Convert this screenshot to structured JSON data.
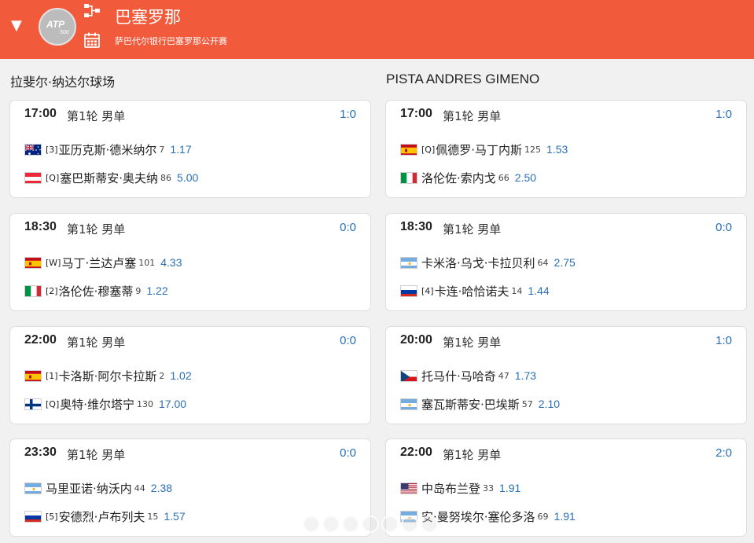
{
  "header": {
    "tournament_name": "巴塞罗那",
    "tournament_full": "萨巴代尔银行巴塞罗那公开赛",
    "logo_text": "ATP",
    "logo_number": "500",
    "accent_color": "#f15a3b"
  },
  "courts": [
    {
      "name": "拉斐尔·纳达尔球场",
      "matches": [
        {
          "time": "17:00",
          "round": "第1轮 男单",
          "score": "1:0",
          "p1": {
            "flag": "australia",
            "seed": "[3]",
            "name": "亚历克斯·德米纳尔",
            "rank": "7",
            "odds": "1.17"
          },
          "p2": {
            "flag": "austria",
            "seed": "[Q]",
            "name": "塞巴斯蒂安·奥夫纳",
            "rank": "86",
            "odds": "5.00"
          }
        },
        {
          "time": "18:30",
          "round": "第1轮 男单",
          "score": "0:0",
          "p1": {
            "flag": "spain",
            "seed": "[W]",
            "name": "马丁·兰达卢塞",
            "rank": "101",
            "odds": "4.33"
          },
          "p2": {
            "flag": "italy",
            "seed": "[2]",
            "name": "洛伦佐·穆塞蒂",
            "rank": "9",
            "odds": "1.22"
          }
        },
        {
          "time": "22:00",
          "round": "第1轮 男单",
          "score": "0:0",
          "p1": {
            "flag": "spain",
            "seed": "[1]",
            "name": "卡洛斯·阿尔卡拉斯",
            "rank": "2",
            "odds": "1.02"
          },
          "p2": {
            "flag": "finland",
            "seed": "[Q]",
            "name": "奥特·维尔塔宁",
            "rank": "130",
            "odds": "17.00"
          }
        },
        {
          "time": "23:30",
          "round": "第1轮 男单",
          "score": "0:0",
          "p1": {
            "flag": "argentina",
            "seed": "",
            "name": "马里亚诺·纳沃内",
            "rank": "44",
            "odds": "2.38"
          },
          "p2": {
            "flag": "russia",
            "seed": "[5]",
            "name": "安德烈·卢布列夫",
            "rank": "15",
            "odds": "1.57"
          }
        }
      ]
    },
    {
      "name": "PISTA ANDRES GIMENO",
      "matches": [
        {
          "time": "17:00",
          "round": "第1轮 男单",
          "score": "1:0",
          "p1": {
            "flag": "spain",
            "seed": "[Q]",
            "name": "佩德罗·马丁内斯",
            "rank": "125",
            "odds": "1.53"
          },
          "p2": {
            "flag": "italy",
            "seed": "",
            "name": "洛伦佐·索内戈",
            "rank": "66",
            "odds": "2.50"
          }
        },
        {
          "time": "18:30",
          "round": "第1轮 男单",
          "score": "0:0",
          "p1": {
            "flag": "argentina",
            "seed": "",
            "name": "卡米洛·乌戈·卡拉贝利",
            "rank": "64",
            "odds": "2.75"
          },
          "p2": {
            "flag": "russia",
            "seed": "[4]",
            "name": "卡连·哈恰诺夫",
            "rank": "14",
            "odds": "1.44"
          }
        },
        {
          "time": "20:00",
          "round": "第1轮 男单",
          "score": "1:0",
          "p1": {
            "flag": "czech",
            "seed": "",
            "name": "托马什·马哈奇",
            "rank": "47",
            "odds": "1.73"
          },
          "p2": {
            "flag": "argentina",
            "seed": "",
            "name": "塞瓦斯蒂安·巴埃斯",
            "rank": "57",
            "odds": "2.10"
          }
        },
        {
          "time": "22:00",
          "round": "第1轮 男单",
          "score": "2:0",
          "p1": {
            "flag": "usa",
            "seed": "",
            "name": "中岛布兰登",
            "rank": "33",
            "odds": "1.91"
          },
          "p2": {
            "flag": "argentina",
            "seed": "",
            "name": "安·曼努埃尔·塞伦多洛",
            "rank": "69",
            "odds": "1.91"
          }
        }
      ]
    }
  ]
}
